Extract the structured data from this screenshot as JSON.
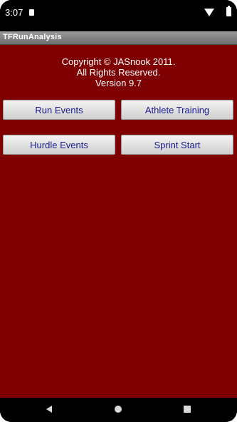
{
  "status_bar": {
    "time": "3:07"
  },
  "app": {
    "title": "TFRunAnalysis"
  },
  "copyright": {
    "line1": "Copyright © JASnook 2011.",
    "line2": "All Rights Reserved.",
    "line3": "Version 9.7"
  },
  "buttons": {
    "run_events": "Run Events",
    "athlete_training": "Athlete Training",
    "hurdle_events": "Hurdle Events",
    "sprint_start": "Sprint Start"
  },
  "colors": {
    "background": "#7f0000",
    "button_text": "#1a1a90"
  }
}
